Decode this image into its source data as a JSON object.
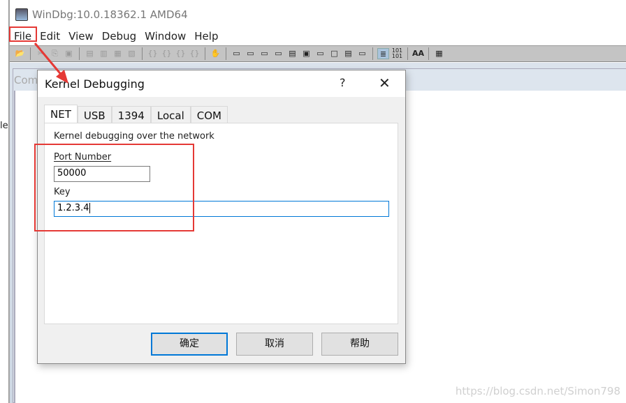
{
  "app": {
    "title": "WinDbg:10.0.18362.1 AMD64",
    "icon": "windbg-icon"
  },
  "menu": [
    "File",
    "Edit",
    "View",
    "Debug",
    "Window",
    "Help"
  ],
  "toolbar": {
    "icons": [
      "open-icon",
      "cut-icon",
      "copy-icon",
      "paste-icon",
      "insert-breakpoint-icon",
      "remove-breakpoint-icon",
      "source-mode-icon",
      "disasm-mode-icon",
      "step-into-icon",
      "step-over-icon",
      "step-out-icon",
      "run-to-cursor-icon",
      "hand-icon",
      "command-icon",
      "watch-icon",
      "locals-icon",
      "registers-icon",
      "memory-icon",
      "call-stack-icon",
      "disassembly-icon",
      "scratch-pad-icon",
      "processes-threads-icon",
      "command-browser-icon",
      "source-mode-toggle-icon",
      "hex-display-icon",
      "font-icon",
      "options-icon"
    ],
    "hex_label": "101\n101",
    "font_label": "AA"
  },
  "background": {
    "inner_window_title": "Com",
    "left_fragment": "le"
  },
  "dialog": {
    "title": "Kernel Debugging",
    "help_label": "?",
    "close_label": "✕",
    "tabs": [
      {
        "label": "NET",
        "active": true
      },
      {
        "label": "USB"
      },
      {
        "label": "1394"
      },
      {
        "label": "Local"
      },
      {
        "label": "COM"
      }
    ],
    "description": "Kernel debugging over the network",
    "port_label": "Port Number",
    "port_value": "50000",
    "key_label": "Key",
    "key_value": "1.2.3.4",
    "buttons": {
      "ok": "确定",
      "cancel": "取消",
      "help": "帮助"
    }
  },
  "annotation_color": "#e53935",
  "watermark": "https://blog.csdn.net/Simon798"
}
